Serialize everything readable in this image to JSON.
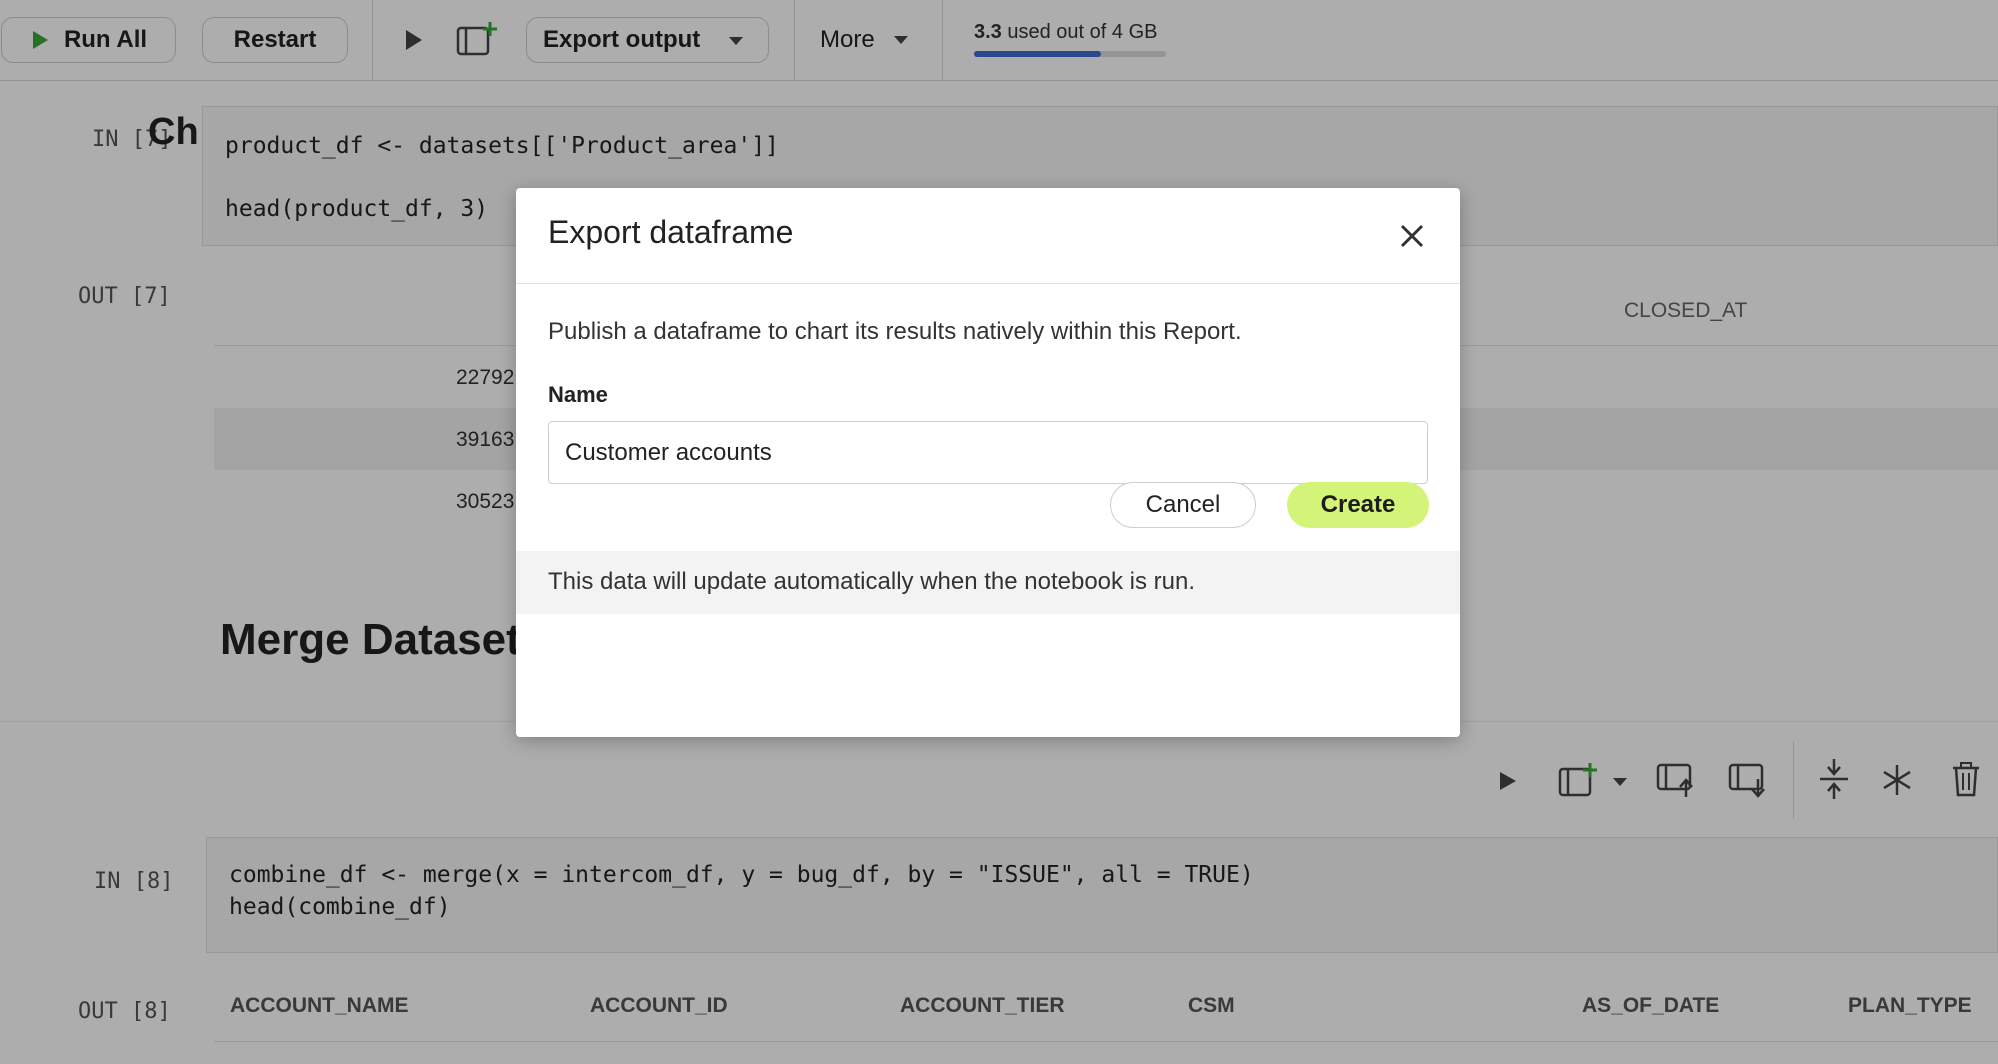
{
  "toolbar": {
    "run_all": "Run All",
    "restart": "Restart",
    "export_output": "Export output",
    "more": "More",
    "memory_used": "3.3",
    "memory_text": "used out of 4 GB",
    "memory_fraction": 0.66
  },
  "cell7": {
    "in_label": "IN [7]",
    "out_label": "OUT [7]",
    "heading_partial": "Ch",
    "code_lines": [
      "product_df <- datasets[['Product_area']]",
      "head(product_df, 3)"
    ],
    "column_closed_at": "CLOSED_AT",
    "row_values": [
      "22792",
      "39163",
      "30523"
    ]
  },
  "merge_heading": "Merge Datasets",
  "cell8": {
    "in_label": "IN [8]",
    "out_label": "OUT [8]",
    "code_lines": [
      "combine_df <- merge(x = intercom_df, y = bug_df, by = \"ISSUE\", all = TRUE)",
      "head(combine_df)"
    ],
    "columns": [
      "ACCOUNT_NAME",
      "ACCOUNT_ID",
      "ACCOUNT_TIER",
      "CSM",
      "AS_OF_DATE",
      "PLAN_TYPE"
    ]
  },
  "modal": {
    "title": "Export dataframe",
    "description": "Publish a dataframe to chart its results natively within this Report.",
    "name_label": "Name",
    "name_value": "Customer accounts",
    "cancel": "Cancel",
    "create": "Create",
    "note": "This data will update automatically when the notebook is run."
  },
  "colors": {
    "accent_green": "#d4f479",
    "run_green": "#3aa83a",
    "memory_blue": "#3d6bd1"
  }
}
